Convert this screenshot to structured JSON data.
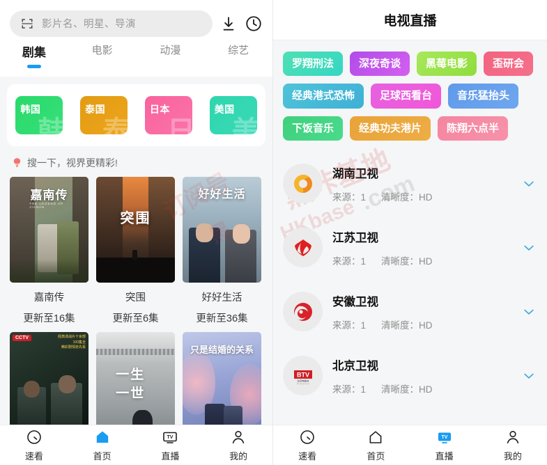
{
  "left": {
    "search": {
      "placeholder": "影片名、明星、导演",
      "scan_icon": "scan-icon",
      "download_icon": "download-icon",
      "history_icon": "clock-history-icon"
    },
    "tabs": [
      {
        "label": "剧集",
        "active": true
      },
      {
        "label": "电影",
        "active": false
      },
      {
        "label": "动漫",
        "active": false
      },
      {
        "label": "综艺",
        "active": false
      }
    ],
    "regions": [
      {
        "label": "韩国",
        "ghost": "韩",
        "color1": "#2bd96a",
        "color2": "#35e07a"
      },
      {
        "label": "泰国",
        "ghost": "泰",
        "color1": "#e29b12",
        "color2": "#eda51c"
      },
      {
        "label": "日本",
        "ghost": "日",
        "color1": "#f9639d",
        "color2": "#fb73a9"
      },
      {
        "label": "美国",
        "ghost": "美",
        "color1": "#2ed6ad",
        "color2": "#3ad9b7"
      }
    ],
    "tip": {
      "icon": "lightbulb-icon",
      "text": "搜一下，视界更精彩!"
    },
    "posters": [
      {
        "title": "嘉南传",
        "sub": "更新至16集",
        "art": "jianan"
      },
      {
        "title": "突围",
        "sub": "更新至6集",
        "art": "tuwei"
      },
      {
        "title": "好好生活",
        "sub": "更新至36集",
        "art": "haohao"
      },
      {
        "title": "",
        "sub": "",
        "art": "cctv"
      },
      {
        "title": "",
        "sub": "",
        "art": "yishi"
      },
      {
        "title": "",
        "sub": "",
        "art": "jiehun"
      }
    ],
    "nav": [
      {
        "label": "速看",
        "icon": "speed-clock-icon",
        "active": false
      },
      {
        "label": "首页",
        "icon": "home-icon",
        "active": true
      },
      {
        "label": "直播",
        "icon": "tv-icon",
        "active": false
      },
      {
        "label": "我的",
        "icon": "user-icon",
        "active": false
      }
    ]
  },
  "right": {
    "title": "电视直播",
    "tags": [
      {
        "label": "罗翔刑法",
        "c1": "#4fe0b4",
        "c2": "#36d6c3"
      },
      {
        "label": "深夜奇谈",
        "c1": "#b14ce8",
        "c2": "#d45ff0"
      },
      {
        "label": "黑莓电影",
        "c1": "#a8e85a",
        "c2": "#8fdd3e"
      },
      {
        "label": "歪研会",
        "c1": "#f2637f",
        "c2": "#f5708c"
      },
      {
        "label": "经典港式恐怖",
        "c1": "#4fc3d9",
        "c2": "#3fb0d6"
      },
      {
        "label": "足球西看台",
        "c1": "#e662e0",
        "c2": "#f157d8"
      },
      {
        "label": "音乐猛抬头",
        "c1": "#5f9aea",
        "c2": "#6fa6ef"
      },
      {
        "label": "下饭音乐",
        "c1": "#3fd07d",
        "c2": "#4ada8c"
      },
      {
        "label": "经典功夫港片",
        "c1": "#e8a338",
        "c2": "#eead45"
      },
      {
        "label": "陈翔六点半",
        "c1": "#f585a0",
        "c2": "#f792aa"
      }
    ],
    "meta_labels": {
      "source": "来源：",
      "quality": "清晰度："
    },
    "channels": [
      {
        "name": "湖南卫视",
        "source": "1",
        "quality": "HD",
        "logo": "hunan-tv-logo"
      },
      {
        "name": "江苏卫视",
        "source": "1",
        "quality": "HD",
        "logo": "jiangsu-tv-logo"
      },
      {
        "name": "安徽卫视",
        "source": "1",
        "quality": "HD",
        "logo": "anhui-tv-logo"
      },
      {
        "name": "北京卫视",
        "source": "1",
        "quality": "HD",
        "logo": "btv-logo"
      }
    ],
    "nav": [
      {
        "label": "速看",
        "icon": "speed-clock-icon",
        "active": false
      },
      {
        "label": "首页",
        "icon": "home-icon",
        "active": false
      },
      {
        "label": "直播",
        "icon": "tv-icon",
        "active": true
      },
      {
        "label": "我的",
        "icon": "user-icon",
        "active": false
      }
    ]
  },
  "watermarks": [
    "订阅号：黑咔基地",
    "HKbase.com"
  ],
  "accent": "#1a9cf0"
}
